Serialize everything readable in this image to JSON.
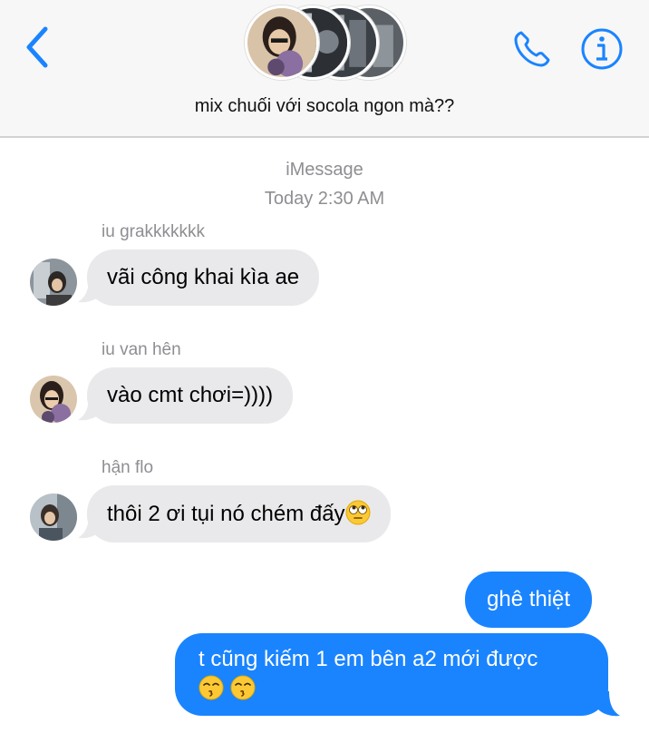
{
  "header": {
    "title": "mix chuối với socola ngon mà??"
  },
  "thread": {
    "service": "iMessage",
    "timestamp": "Today 2:30 AM"
  },
  "messages": [
    {
      "sender": "iu grakkkkkkk",
      "text": "vãi công khai kìa ae"
    },
    {
      "sender": "iu van hên",
      "text": "vào cmt chơi=))))"
    },
    {
      "sender": "hận flo",
      "text": "thôi 2 ơi tụi nó chém đấy"
    },
    {
      "text": "ghê thiệt"
    },
    {
      "text": "t cũng kiếm 1 em bên a2 mới được"
    }
  ],
  "colors": {
    "accent": "#1a84ff",
    "incoming_bubble": "#e9e9eb",
    "meta_text": "#8e8e93"
  },
  "icons": [
    "chevron-left-icon",
    "phone-icon",
    "info-icon",
    "rolling-eyes-emoji",
    "kissing-emoji"
  ]
}
